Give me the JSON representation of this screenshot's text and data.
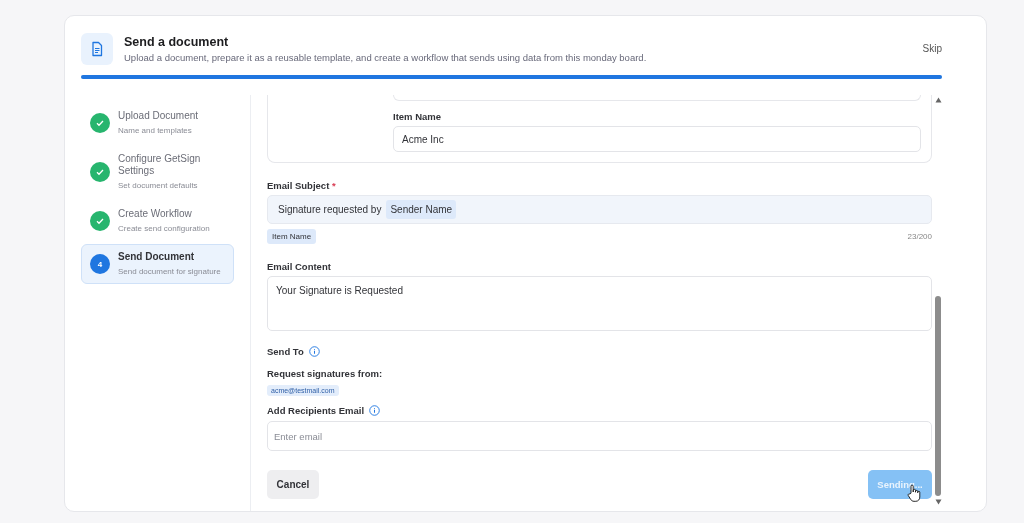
{
  "header": {
    "title": "Send a document",
    "subtitle": "Upload a document, prepare it as a reusable template, and create a workflow that sends using data from this monday board.",
    "skip": "Skip",
    "progress": {
      "level": 1
    }
  },
  "steps": [
    {
      "title": "Upload Document",
      "subtitle": "Name and templates",
      "completed": true,
      "selected": false
    },
    {
      "title": "Configure GetSign Settings",
      "subtitle": "Set document defaults",
      "completed": true,
      "selected": false
    },
    {
      "title": "Create Workflow",
      "subtitle": "Create send configuration",
      "completed": true,
      "selected": false
    },
    {
      "title": "Send Document",
      "subtitle": "Send document for signature",
      "completed": false,
      "selected": true,
      "number": "4"
    }
  ],
  "item_name": {
    "label": "Item Name",
    "value": "Acme Inc"
  },
  "email_subject": {
    "label": "Email Subject",
    "required_mark": "*",
    "text": "Signature requested by",
    "token": "Sender Name",
    "chips": [
      "Item Name"
    ],
    "counter": "23/200"
  },
  "email_content": {
    "label": "Email Content",
    "value": "Your Signature is Requested"
  },
  "send_to": {
    "label": "Send To",
    "request_label": "Request signatures from:",
    "recipients": [
      "acme@testmail.com"
    ],
    "add_label": "Add Recipients Email",
    "placeholder": "Enter email"
  },
  "buttons": {
    "cancel": "Cancel",
    "send": "Sending...",
    "send_busy": true
  }
}
